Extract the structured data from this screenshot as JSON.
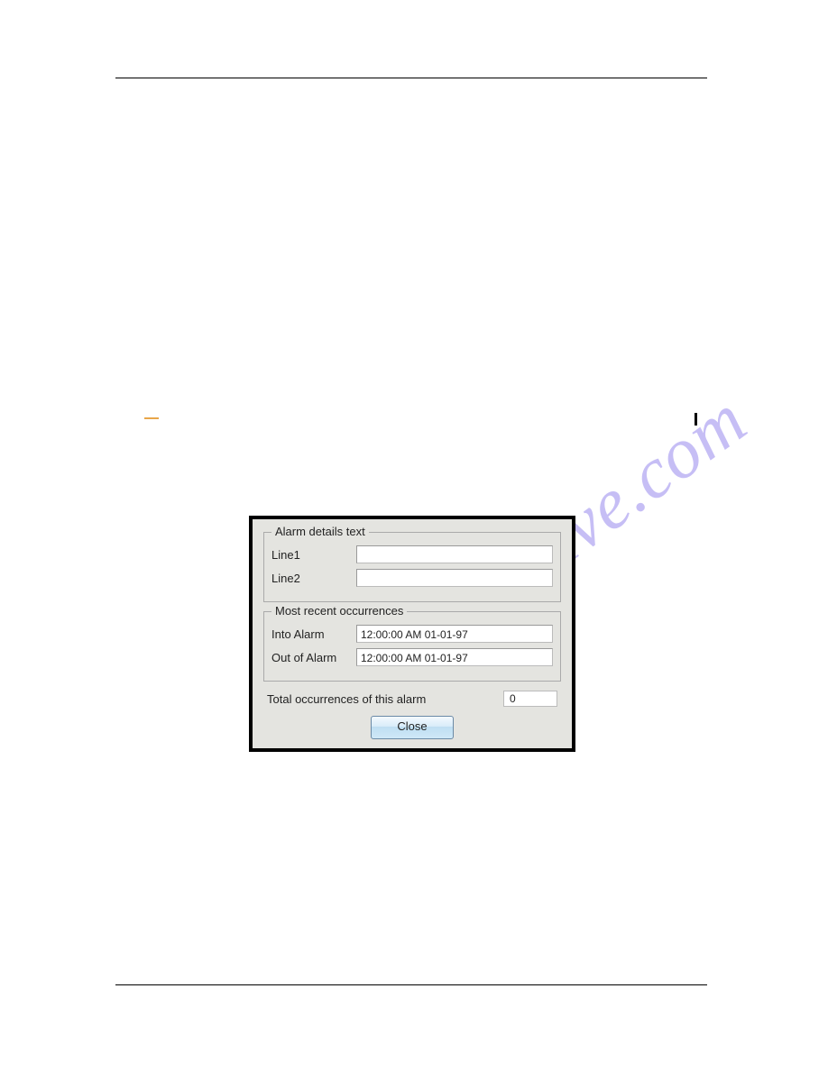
{
  "watermark": "manualshive.com",
  "dialog": {
    "groups": {
      "details": {
        "legend": "Alarm details text",
        "line1_label": "Line1",
        "line1_value": "",
        "line2_label": "Line2",
        "line2_value": ""
      },
      "recent": {
        "legend": "Most recent occurrences",
        "into_label": "Into Alarm",
        "into_value": "12:00:00 AM 01-01-97",
        "out_label": "Out of Alarm",
        "out_value": "12:00:00 AM 01-01-97"
      }
    },
    "total": {
      "label": "Total occurrences of this alarm",
      "value": "0"
    },
    "close_label": "Close"
  }
}
